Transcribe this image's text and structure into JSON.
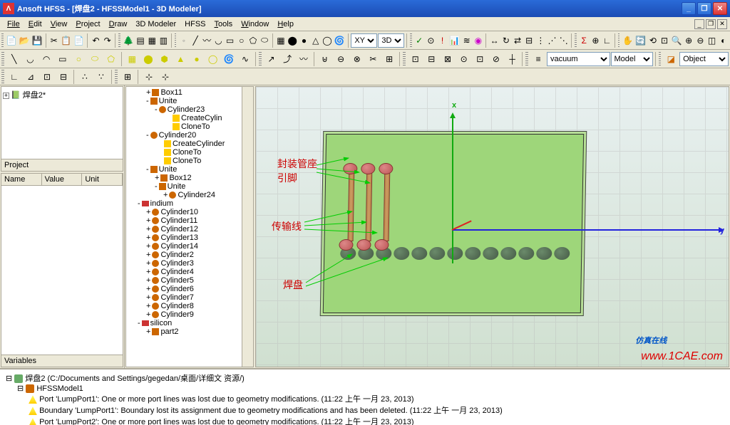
{
  "titlebar": {
    "app": "Ansoft HFSS - ",
    "doc": "[焊盘2 - HFSSModel1 - 3D Modeler]"
  },
  "menu": [
    "File",
    "Edit",
    "View",
    "Project",
    "Draw",
    "3D Modeler",
    "HFSS",
    "Tools",
    "Window",
    "Help"
  ],
  "toolbars": {
    "row1_selects": {
      "cs": "XY",
      "mode3d": "3D"
    },
    "row2_selects": {
      "material": "vacuum",
      "scope": "Model",
      "selmode": "Object"
    }
  },
  "project_panel": {
    "title": "Project",
    "item": "焊盘2*"
  },
  "props_panel": {
    "title": "Variables",
    "cols": [
      "Name",
      "Value",
      "Unit"
    ]
  },
  "model_tree": [
    {
      "d": 2,
      "e": "+",
      "i": "cube",
      "t": "Box11"
    },
    {
      "d": 2,
      "e": "-",
      "i": "cube",
      "t": "Unite"
    },
    {
      "d": 3,
      "e": "-",
      "i": "cyl",
      "t": "Cylinder23"
    },
    {
      "d": 4,
      "e": "",
      "i": "cmd",
      "t": "CreateCylin"
    },
    {
      "d": 4,
      "e": "",
      "i": "cmd",
      "t": "CloneTo"
    },
    {
      "d": 2,
      "e": "-",
      "i": "cyl",
      "t": "Cylinder20"
    },
    {
      "d": 3,
      "e": "",
      "i": "cmd",
      "t": "CreateCylinder"
    },
    {
      "d": 3,
      "e": "",
      "i": "cmd",
      "t": "CloneTo"
    },
    {
      "d": 3,
      "e": "",
      "i": "cmd",
      "t": "CloneTo"
    },
    {
      "d": 2,
      "e": "-",
      "i": "cube",
      "t": "Unite"
    },
    {
      "d": 3,
      "e": "+",
      "i": "cube",
      "t": "Box12"
    },
    {
      "d": 3,
      "e": "-",
      "i": "cube",
      "t": "Unite"
    },
    {
      "d": 4,
      "e": "+",
      "i": "cyl",
      "t": "Cylinder24"
    },
    {
      "d": 1,
      "e": "-",
      "i": "mat",
      "t": "indium"
    },
    {
      "d": 2,
      "e": "+",
      "i": "cyl",
      "t": "Cylinder10"
    },
    {
      "d": 2,
      "e": "+",
      "i": "cyl",
      "t": "Cylinder11"
    },
    {
      "d": 2,
      "e": "+",
      "i": "cyl",
      "t": "Cylinder12"
    },
    {
      "d": 2,
      "e": "+",
      "i": "cyl",
      "t": "Cylinder13"
    },
    {
      "d": 2,
      "e": "+",
      "i": "cyl",
      "t": "Cylinder14"
    },
    {
      "d": 2,
      "e": "+",
      "i": "cyl",
      "t": "Cylinder2"
    },
    {
      "d": 2,
      "e": "+",
      "i": "cyl",
      "t": "Cylinder3"
    },
    {
      "d": 2,
      "e": "+",
      "i": "cyl",
      "t": "Cylinder4"
    },
    {
      "d": 2,
      "e": "+",
      "i": "cyl",
      "t": "Cylinder5"
    },
    {
      "d": 2,
      "e": "+",
      "i": "cyl",
      "t": "Cylinder6"
    },
    {
      "d": 2,
      "e": "+",
      "i": "cyl",
      "t": "Cylinder7"
    },
    {
      "d": 2,
      "e": "+",
      "i": "cyl",
      "t": "Cylinder8"
    },
    {
      "d": 2,
      "e": "+",
      "i": "cyl",
      "t": "Cylinder9"
    },
    {
      "d": 1,
      "e": "-",
      "i": "mat",
      "t": "silicon"
    },
    {
      "d": 2,
      "e": "+",
      "i": "cube",
      "t": "part2"
    }
  ],
  "annotations": {
    "a1": "封装管座\n引脚",
    "a2": "传输线",
    "a3": "焊盘"
  },
  "axes": {
    "x": "x",
    "y": "y"
  },
  "messages": {
    "root": "焊盘2 (C:/Documents and Settings/gegedan/桌面/详细文 资源/)",
    "model": "HFSSModel1",
    "lines": [
      "Port 'LumpPort1': One or more port lines was lost due to geometry modifications. (11:22 上午  一月 23, 2013)",
      "Boundary 'LumpPort1': Boundary lost its assignment due to geometry modifications and has been deleted. (11:22 上午  一月 23, 2013)",
      "Port 'LumpPort2': One or more port lines was lost due to geometry modifications. (11:22 上午  一月 23, 2013)"
    ]
  },
  "watermark": {
    "t1": "仿真在线",
    "t2": "www.1CAE.com"
  }
}
